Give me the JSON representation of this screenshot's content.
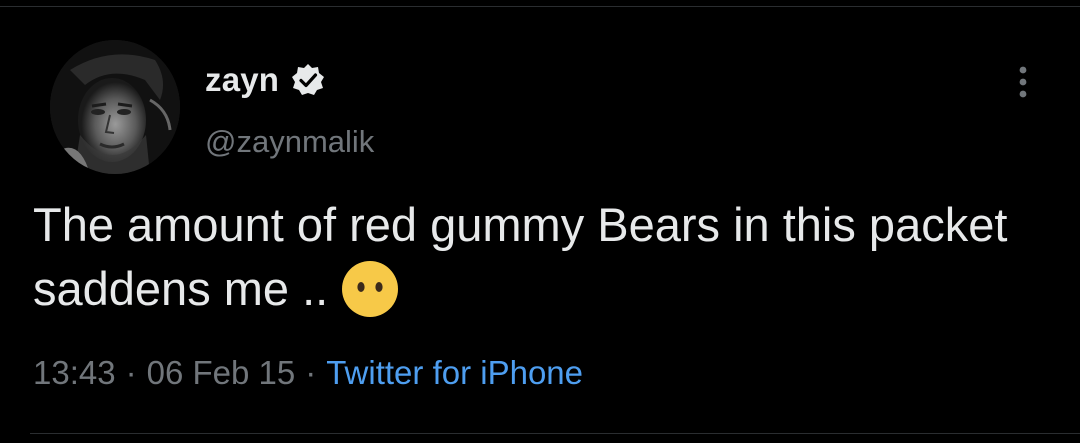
{
  "user": {
    "display_name": "zayn",
    "handle": "@zaynmalik",
    "verified": true
  },
  "tweet": {
    "text": "The amount of red gummy Bears in this packet saddens me ..",
    "emoji": "neutral-face-no-mouth-emoji"
  },
  "meta": {
    "time": "13:43",
    "separator": "·",
    "date": "06 Feb 15",
    "source": "Twitter for iPhone"
  },
  "icons": {
    "verified": "verified-badge-icon",
    "more": "more-options-icon"
  },
  "colors": {
    "background": "#000000",
    "text": "#e7e9ea",
    "muted": "#71767b",
    "link": "#4e9ef0",
    "emoji": "#f7c948"
  }
}
